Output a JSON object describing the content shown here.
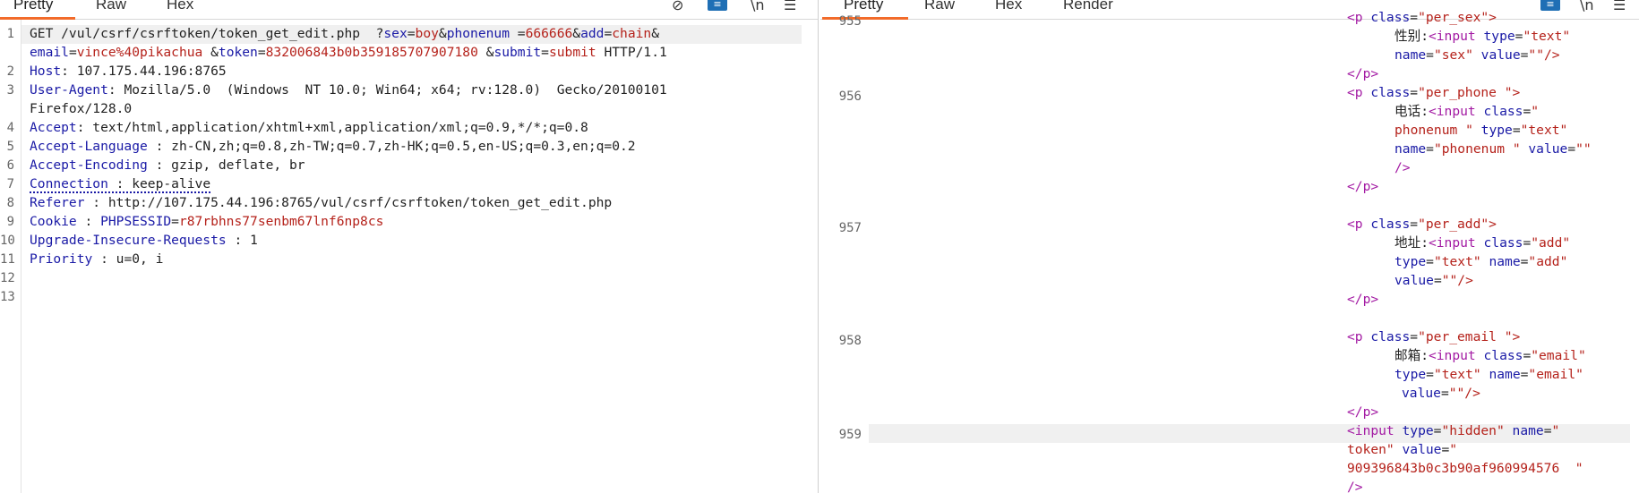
{
  "left": {
    "tabs": [
      "Pretty",
      "Raw",
      "Hex"
    ],
    "icons": [
      "hide-icon",
      "wrap-icon",
      "newline-icon",
      "menu-icon"
    ],
    "line_numbers": [
      "1",
      "2",
      "3",
      "4",
      "5",
      "6",
      "7",
      "8",
      "9",
      "10",
      "11",
      "12",
      "13"
    ],
    "request": {
      "method_path": "GET /vul/csrf/csrftoken/token_get_edit.php  ?",
      "q_sex_key": "sex",
      "q_sex_val": "boy",
      "q_phone_key": "phonenum ",
      "q_phone_val": "666666",
      "q_add_key": "add",
      "q_add_val": "chain",
      "q_email_key": "email",
      "q_email_val": "vince%40pikachua ",
      "q_token_key": "token",
      "q_token_val": "832006843b0b359185707907180 ",
      "q_submit_key": "submit",
      "q_submit_val": "submit",
      "http_version": " HTTP/1.1",
      "host_key": "Host",
      "host_val": " 107.175.44.196:8765",
      "ua_key": "User-Agent",
      "ua_val1": " Mozilla/5.0  (Windows  NT 10.0; Win64; x64; rv:128.0)  Gecko/20100101",
      "ua_val2": "Firefox/128.0",
      "accept_key": "Accept",
      "accept_val": " text/html,application/xhtml+xml,application/xml;q=0.9,*/*;q=0.8",
      "lang_key": "Accept-Language ",
      "lang_val": " zh-CN,zh;q=0.8,zh-TW;q=0.7,zh-HK;q=0.5,en-US;q=0.3,en;q=0.2",
      "enc_key": "Accept-Encoding ",
      "enc_val": " gzip, deflate, br",
      "conn_key": "Connection ",
      "conn_val": " keep-alive",
      "ref_key": "Referer ",
      "ref_val": " http://107.175.44.196:8765/vul/csrf/csrftoken/token_get_edit.php",
      "cookie_key": "Cookie ",
      "cookie_name": "PHPSESSID",
      "cookie_val": "r87rbhns77senbm67lnf6np8cs",
      "uir_key": "Upgrade-Insecure-Requests ",
      "uir_val": " 1",
      "prio_key": "Priority ",
      "prio_val": " u=0, i"
    }
  },
  "right": {
    "tabs": [
      "Pretty",
      "Raw",
      "Hex",
      "Render"
    ],
    "icons": [
      "wrap-icon",
      "newline-icon",
      "menu-icon"
    ],
    "line_numbers": [
      "955",
      "956",
      "957",
      "958",
      "959"
    ],
    "lines": {
      "r0_tag": "<p ",
      "r0_attr": "class",
      "r0_val": "\"per_sex\">",
      "r1_text": "性别:",
      "r1_tag": "<input ",
      "r1_attr": "type",
      "r1_val": "\"text\"",
      "r2_attr1": "name",
      "r2_val1": "\"sex\" ",
      "r2_attr2": "value",
      "r2_val2": "\"\"/>",
      "r3_tag": "</p>",
      "r4_tag": "<p ",
      "r4_attr": "class",
      "r4_val": "\"per_phone \">",
      "r5_text": "电话:",
      "r5_tag": "<input ",
      "r5_attr": "class",
      "r5_val": "\"",
      "r6_val": "phonenum \" ",
      "r6_attr": "type",
      "r6_val2": "\"text\"",
      "r7_attr1": "name",
      "r7_val1": "\"phonenum \" ",
      "r7_attr2": "value",
      "r7_val2": "\"\"",
      "r8_tag": "/>",
      "r9_tag": "</p>",
      "r11_tag": "<p ",
      "r11_attr": "class",
      "r11_val": "\"per_add\">",
      "r12_text": "地址:",
      "r12_tag": "<input ",
      "r12_attr": "class",
      "r12_val": "\"add\"",
      "r13_attr1": "type",
      "r13_val1": "\"text\" ",
      "r13_attr2": "name",
      "r13_val2": "\"add\"",
      "r14_attr": "value",
      "r14_val": "\"\"/>",
      "r15_tag": "</p>",
      "r17_tag": "<p ",
      "r17_attr": "class",
      "r17_val": "\"per_email \">",
      "r18_text": "邮箱:",
      "r18_tag": "<input ",
      "r18_attr": "class",
      "r18_val": "\"email\"",
      "r19_attr1": "type",
      "r19_val1": "\"text\" ",
      "r19_attr2": "name",
      "r19_val2": "\"email\"",
      "r20_attr": "value",
      "r20_val": "\"\"/>",
      "r21_tag": "</p>",
      "r22_tag": "<input ",
      "r22_attr1": "type",
      "r22_val1": "\"hidden\" ",
      "r22_attr2": "name",
      "r22_val2": "\"",
      "r23_val": "token\" ",
      "r23_attr": "value",
      "r23_val2": "\"",
      "r24_val": "909396843b0c3b90af960994576  \"",
      "r25_tag": "/>"
    }
  }
}
